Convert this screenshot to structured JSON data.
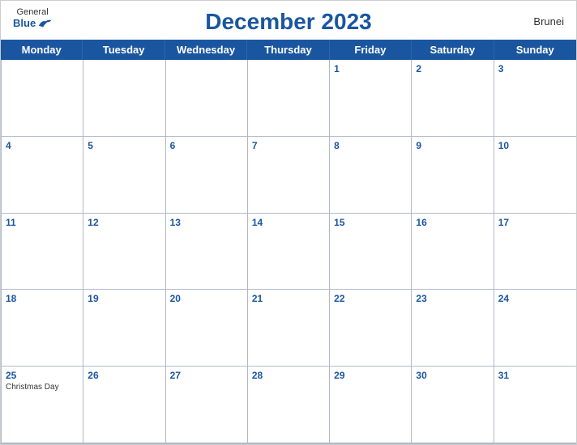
{
  "header": {
    "logo_general": "General",
    "logo_blue": "Blue",
    "title": "December 2023",
    "country": "Brunei"
  },
  "days_of_week": [
    "Monday",
    "Tuesday",
    "Wednesday",
    "Thursday",
    "Friday",
    "Saturday",
    "Sunday"
  ],
  "weeks": [
    [
      {
        "num": "",
        "events": []
      },
      {
        "num": "",
        "events": []
      },
      {
        "num": "",
        "events": []
      },
      {
        "num": "",
        "events": []
      },
      {
        "num": "1",
        "events": []
      },
      {
        "num": "2",
        "events": []
      },
      {
        "num": "3",
        "events": []
      }
    ],
    [
      {
        "num": "4",
        "events": []
      },
      {
        "num": "5",
        "events": []
      },
      {
        "num": "6",
        "events": []
      },
      {
        "num": "7",
        "events": []
      },
      {
        "num": "8",
        "events": []
      },
      {
        "num": "9",
        "events": []
      },
      {
        "num": "10",
        "events": []
      }
    ],
    [
      {
        "num": "11",
        "events": []
      },
      {
        "num": "12",
        "events": []
      },
      {
        "num": "13",
        "events": []
      },
      {
        "num": "14",
        "events": []
      },
      {
        "num": "15",
        "events": []
      },
      {
        "num": "16",
        "events": []
      },
      {
        "num": "17",
        "events": []
      }
    ],
    [
      {
        "num": "18",
        "events": []
      },
      {
        "num": "19",
        "events": []
      },
      {
        "num": "20",
        "events": []
      },
      {
        "num": "21",
        "events": []
      },
      {
        "num": "22",
        "events": []
      },
      {
        "num": "23",
        "events": []
      },
      {
        "num": "24",
        "events": []
      }
    ],
    [
      {
        "num": "25",
        "events": [
          "Christmas Day"
        ]
      },
      {
        "num": "26",
        "events": []
      },
      {
        "num": "27",
        "events": []
      },
      {
        "num": "28",
        "events": []
      },
      {
        "num": "29",
        "events": []
      },
      {
        "num": "30",
        "events": []
      },
      {
        "num": "31",
        "events": []
      }
    ]
  ]
}
